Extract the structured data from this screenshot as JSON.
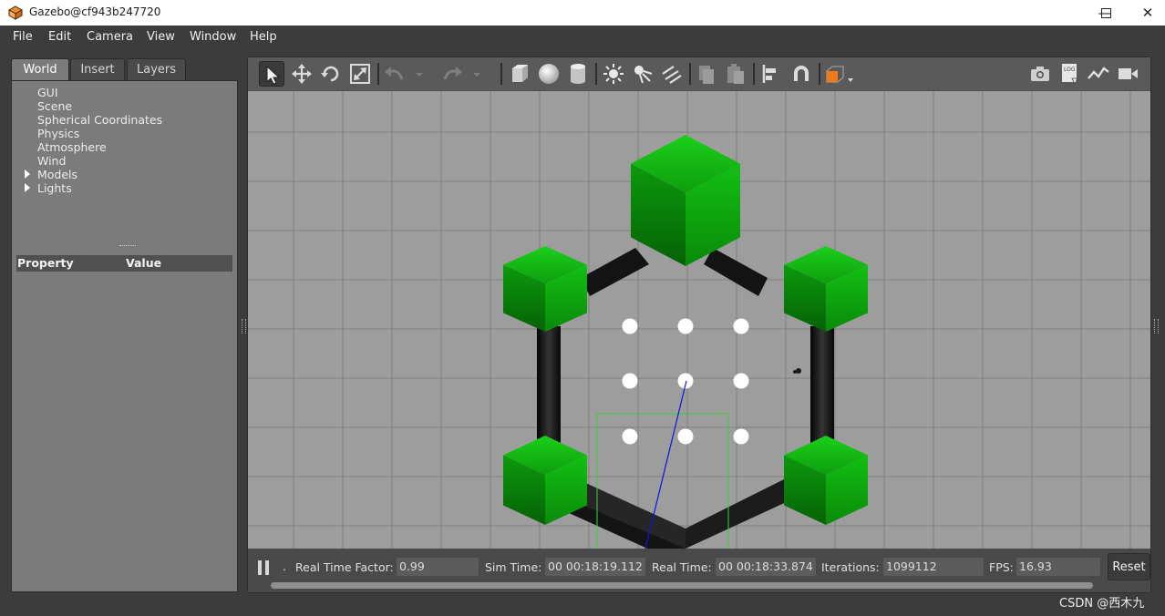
{
  "window": {
    "title": "Gazebo@cf943b247720",
    "minimize_glyph": "—",
    "maximize_glyph": "☐",
    "close_glyph": "✕",
    "app_icon": "gazebo-logo-icon"
  },
  "menubar": {
    "items": [
      {
        "label": "File"
      },
      {
        "label": "Edit"
      },
      {
        "label": "Camera"
      },
      {
        "label": "View"
      },
      {
        "label": "Window"
      },
      {
        "label": "Help"
      }
    ]
  },
  "left_panel": {
    "tabs": [
      {
        "label": "World",
        "active": true
      },
      {
        "label": "Insert",
        "active": false
      },
      {
        "label": "Layers",
        "active": false
      }
    ],
    "tree": [
      {
        "label": "GUI",
        "expandable": false
      },
      {
        "label": "Scene",
        "expandable": false
      },
      {
        "label": "Spherical Coordinates",
        "expandable": false
      },
      {
        "label": "Physics",
        "expandable": false
      },
      {
        "label": "Atmosphere",
        "expandable": false
      },
      {
        "label": "Wind",
        "expandable": false
      },
      {
        "label": "Models",
        "expandable": true
      },
      {
        "label": "Lights",
        "expandable": true
      }
    ],
    "property_header": {
      "property": "Property",
      "value": "Value"
    }
  },
  "toolbar": {
    "tools": [
      "select-arrow-icon",
      "translate-icon",
      "rotate-icon",
      "scale-icon",
      "undo-icon",
      "undo-history-icon",
      "redo-icon",
      "redo-history-icon",
      "box-shape-icon",
      "sphere-shape-icon",
      "cylinder-shape-icon",
      "point-light-icon",
      "spot-light-icon",
      "directional-light-icon",
      "copy-icon",
      "paste-icon",
      "align-icon",
      "snap-magnet-icon",
      "view-angle-icon",
      "screenshot-camera-icon",
      "log-icon",
      "plot-icon",
      "video-record-icon"
    ],
    "accent_orange": "#f07a1a"
  },
  "scene": {
    "background": "#9d9d9d",
    "grid_color": "#7c7c7c",
    "cube_green": "#10b810",
    "link_black": "#151515",
    "marker_white": "#ffffff",
    "selection_green": "#39d039",
    "axis_blue": "#1010d8"
  },
  "statusbar": {
    "real_time_factor_label": "Real Time Factor:",
    "real_time_factor": "0.99",
    "sim_time_label": "Sim Time:",
    "sim_time": "00 00:18:19.112",
    "real_time_label": "Real Time:",
    "real_time": "00 00:18:33.874",
    "iterations_label": "Iterations:",
    "iterations": "1099112",
    "fps_label": "FPS:",
    "fps": "16.93",
    "reset_label": "Reset",
    "step_dot": "."
  },
  "watermark": "CSDN @西木九"
}
